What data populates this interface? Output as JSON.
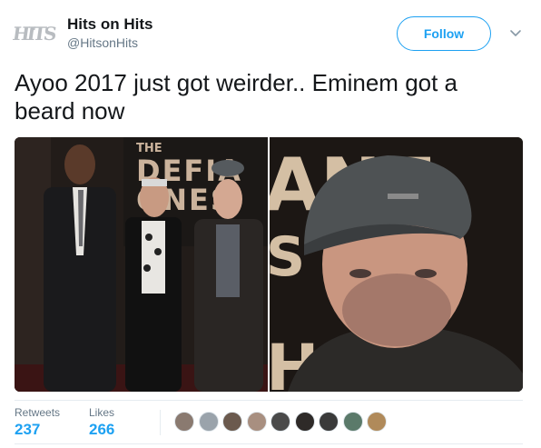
{
  "account": {
    "name": "Hits on Hits",
    "handle": "@HitsonHits",
    "avatar_text": "HITS"
  },
  "follow_label": "Follow",
  "tweet": {
    "text": "Ayoo 2017 just got weirder.. Eminem got a beard now"
  },
  "media": {
    "left_photo_backdrop_text": "THE DEFIANT ONES",
    "right_photo_backdrop_text": "ANT S HBO"
  },
  "stats": {
    "retweets_label": "Retweets",
    "retweets_value": "237",
    "likes_label": "Likes",
    "likes_value": "266"
  },
  "liker_avatars": [
    {
      "name": "liker-avatar-1",
      "color": "#8a7a70"
    },
    {
      "name": "liker-avatar-2",
      "color": "#9aa3ab"
    },
    {
      "name": "liker-avatar-3",
      "color": "#6b5a4e"
    },
    {
      "name": "liker-avatar-4",
      "color": "#a88f80"
    },
    {
      "name": "liker-avatar-5",
      "color": "#4a4a4a"
    },
    {
      "name": "liker-avatar-6",
      "color": "#2e2a28"
    },
    {
      "name": "liker-avatar-7",
      "color": "#3a3a3a"
    },
    {
      "name": "liker-avatar-8",
      "color": "#5b7a6a"
    },
    {
      "name": "liker-avatar-9",
      "color": "#b08a5a"
    }
  ],
  "colors": {
    "accent": "#1da1f2",
    "text": "#14171a",
    "secondary_text": "#657786",
    "divider": "#e6ecf0"
  },
  "icons": {
    "caret": "chevron-down-icon"
  }
}
